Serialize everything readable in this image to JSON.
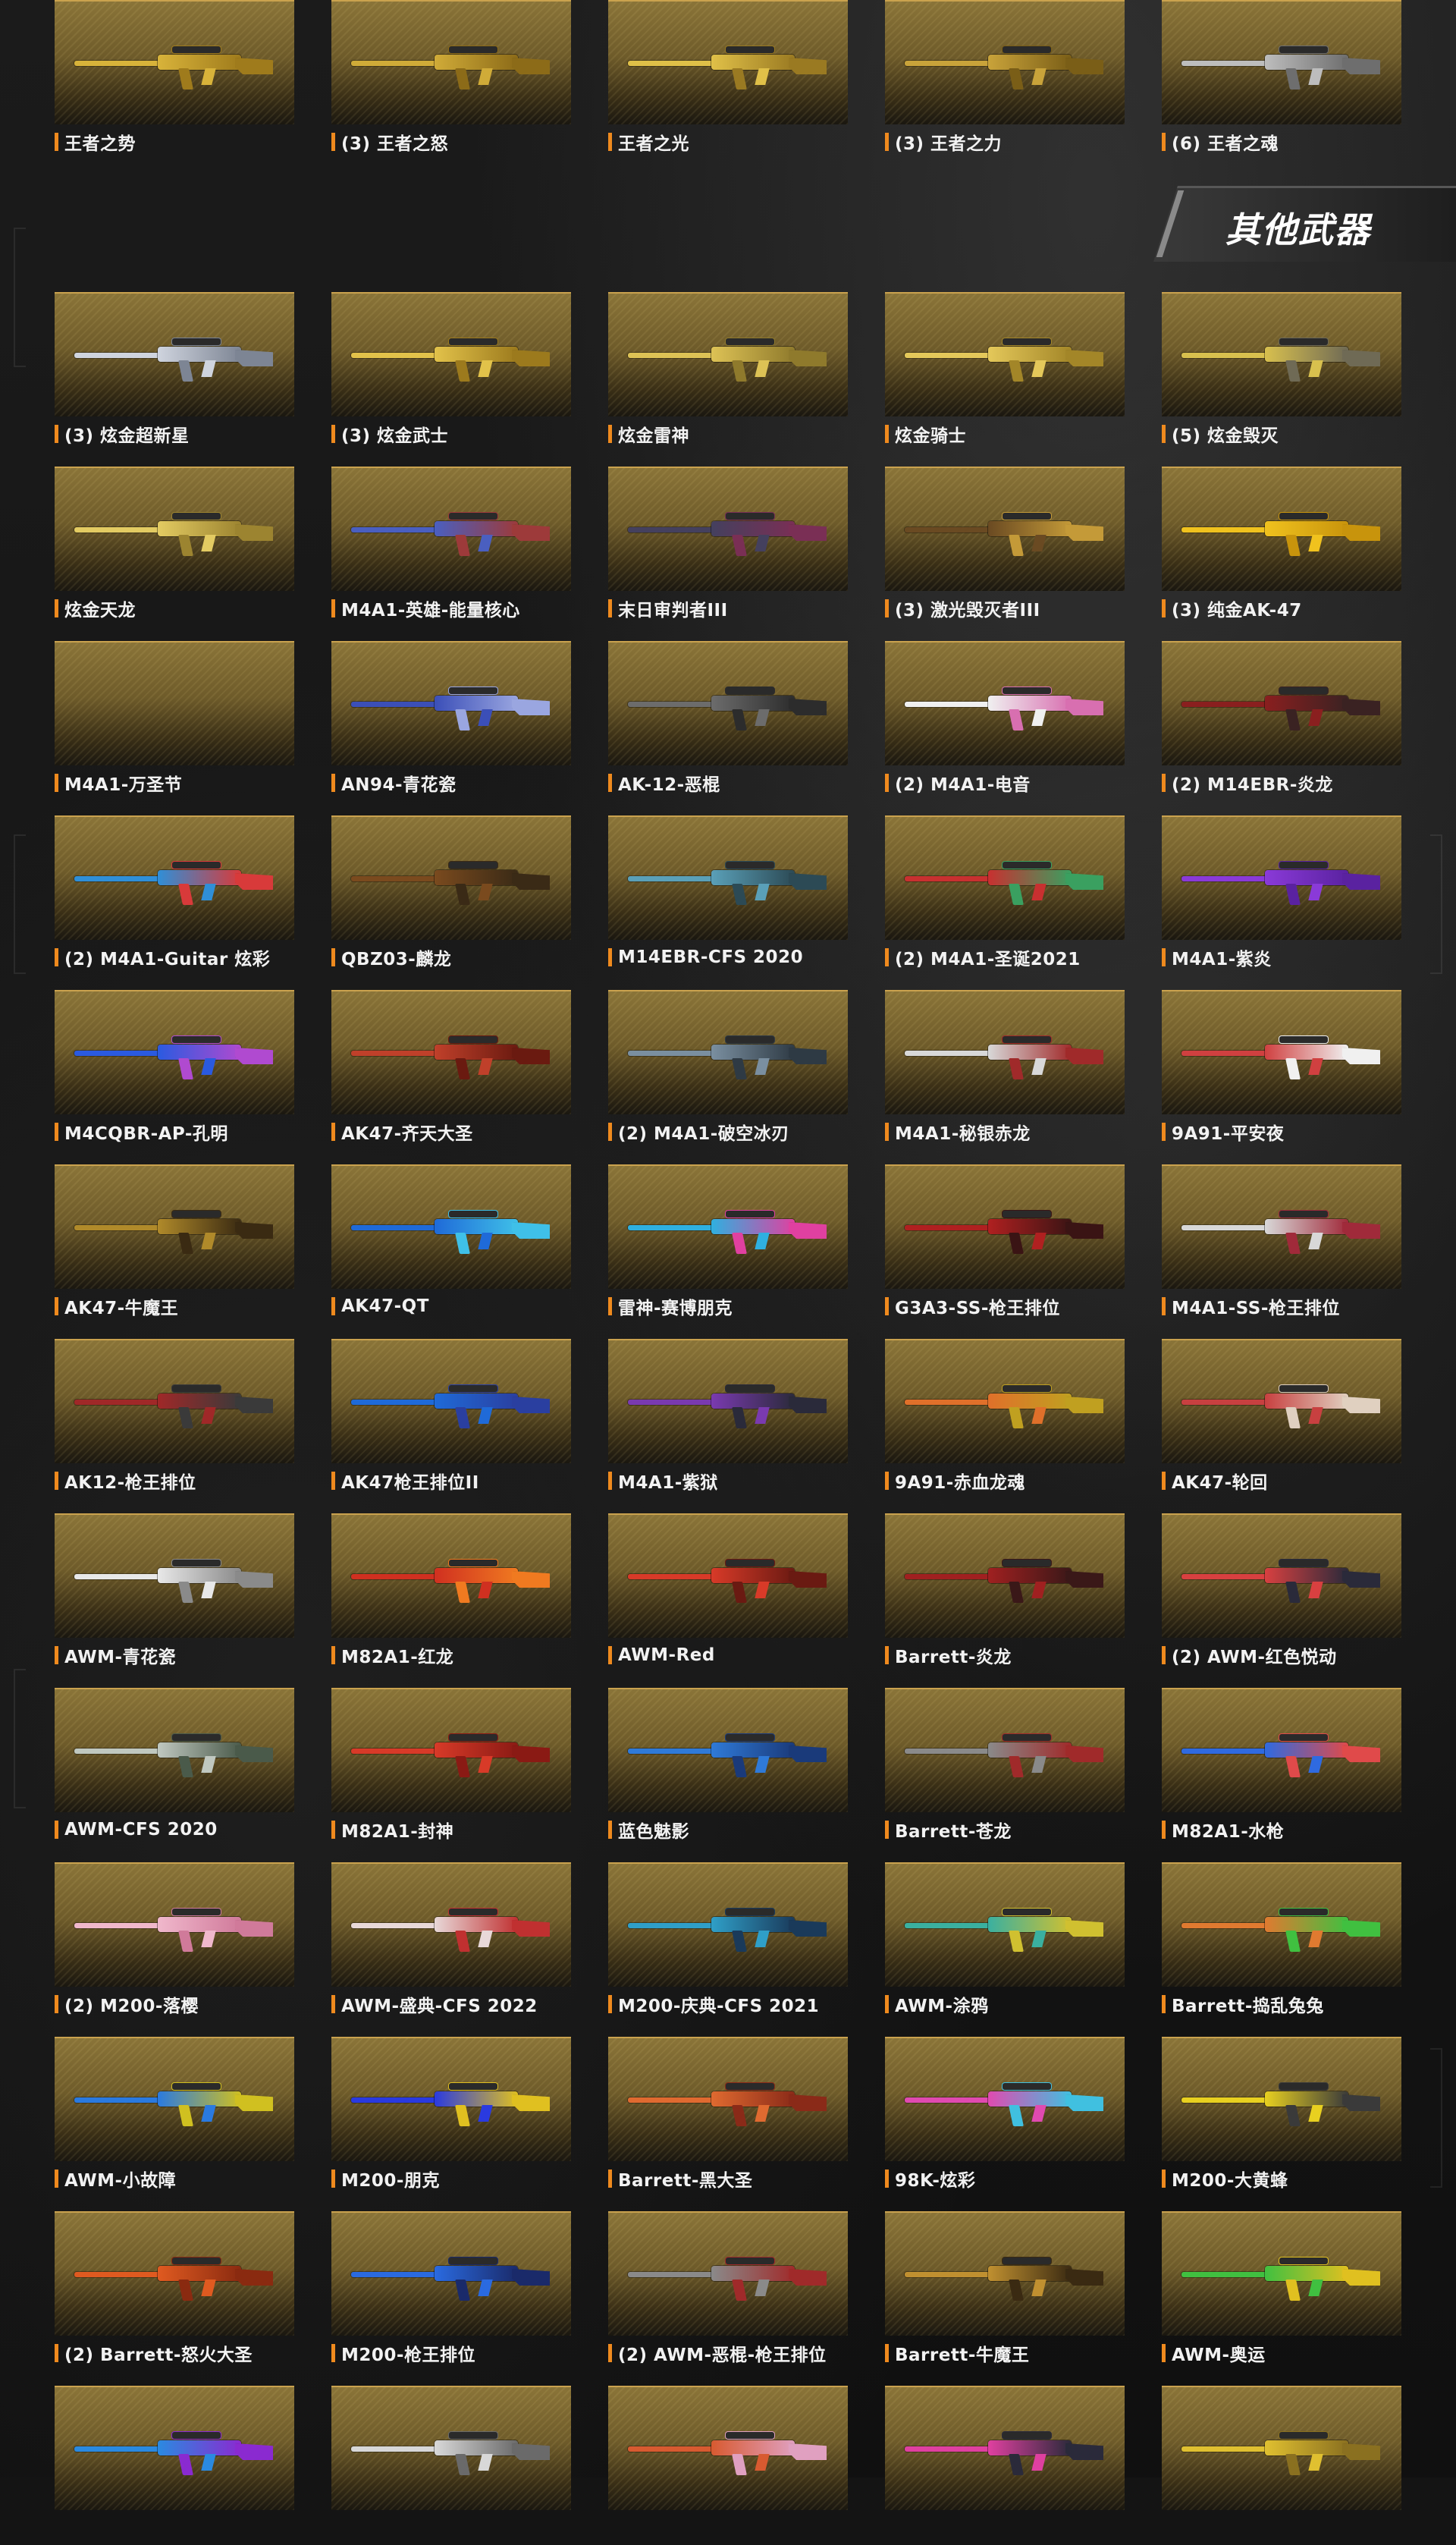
{
  "section": {
    "title": "其他武器"
  },
  "top_items": [
    {
      "name": "王者之势",
      "c1": "#d8b33a",
      "c2": "#9f7b1c"
    },
    {
      "name": "(3) 王者之怒",
      "c1": "#d0ab38",
      "c2": "#8c6b18"
    },
    {
      "name": "王者之光",
      "c1": "#e0c048",
      "c2": "#9a7a22"
    },
    {
      "name": "(3) 王者之力",
      "c1": "#c9a33a",
      "c2": "#7a5e17"
    },
    {
      "name": "(6) 王者之魂",
      "c1": "#bdbdbd",
      "c2": "#6e6e6e"
    }
  ],
  "items": [
    {
      "name": "(3) 炫金超新星",
      "c1": "#cfd4de",
      "c2": "#7d8594"
    },
    {
      "name": "(3) 炫金武士",
      "c1": "#e2c24a",
      "c2": "#9c7a1d"
    },
    {
      "name": "炫金雷神",
      "c1": "#ddc255",
      "c2": "#8f7a2c"
    },
    {
      "name": "炫金骑士",
      "c1": "#e4c85a",
      "c2": "#a38628"
    },
    {
      "name": "(5) 炫金毁灭",
      "c1": "#d8c04e",
      "c2": "#6f6a55"
    },
    {
      "name": "炫金天龙",
      "c1": "#e3cb62",
      "c2": "#9c8430"
    },
    {
      "name": "M4A1-英雄-能量核心",
      "c1": "#4a5fc0",
      "c2": "#9d3a3a"
    },
    {
      "name": "末日审判者III",
      "c1": "#44405e",
      "c2": "#7a2f55"
    },
    {
      "name": "(3) 激光毁灭者III",
      "c1": "#6a4a22",
      "c2": "#c49a38"
    },
    {
      "name": "(3) 纯金AK-47",
      "c1": "#f0c21e",
      "c2": "#c8940c"
    },
    {
      "name": "M4A1-万圣节",
      "c1": "#000000",
      "c2": "#000000"
    },
    {
      "name": "AN94-青花瓷",
      "c1": "#3b4fb8",
      "c2": "#9aa6e0"
    },
    {
      "name": "AK-12-恶棍",
      "c1": "#6c6c6c",
      "c2": "#2c2c2c"
    },
    {
      "name": "(2) M4A1-电音",
      "c1": "#f0f0f0",
      "c2": "#d86fb0"
    },
    {
      "name": "(2) M14EBR-炎龙",
      "c1": "#8a1f1f",
      "c2": "#3a2222"
    },
    {
      "name": "(2) M4A1-Guitar 炫彩",
      "c1": "#2f8fd8",
      "c2": "#d83a3a"
    },
    {
      "name": "QBZ03-麟龙",
      "c1": "#7a4a1e",
      "c2": "#3a2a16"
    },
    {
      "name": "M14EBR-CFS 2020",
      "c1": "#5aa0b8",
      "c2": "#2c4a55"
    },
    {
      "name": "(2) M4A1-圣诞2021",
      "c1": "#c83030",
      "c2": "#3aa060"
    },
    {
      "name": "M4A1-紫炎",
      "c1": "#8a3ad8",
      "c2": "#5a22a0"
    },
    {
      "name": "M4CQBR-AP-孔明",
      "c1": "#2a5ae0",
      "c2": "#b04ad0"
    },
    {
      "name": "AK47-齐天大圣",
      "c1": "#c0402a",
      "c2": "#6a1a10"
    },
    {
      "name": "(2) M4A1-破空冰刃",
      "c1": "#7a8fa0",
      "c2": "#2e3a44"
    },
    {
      "name": "M4A1-秘银赤龙",
      "c1": "#d8d8d8",
      "c2": "#a02a2a"
    },
    {
      "name": "9A91-平安夜",
      "c1": "#d04040",
      "c2": "#f0f0f0"
    },
    {
      "name": "AK47-牛魔王",
      "c1": "#b08a2a",
      "c2": "#3a2a12"
    },
    {
      "name": "AK47-QT",
      "c1": "#1f6ad8",
      "c2": "#3fc0e8"
    },
    {
      "name": "雷神-赛博朋克",
      "c1": "#2fb0e0",
      "c2": "#e040a0"
    },
    {
      "name": "G3A3-SS-枪王排位",
      "c1": "#b02020",
      "c2": "#3a1414"
    },
    {
      "name": "M4A1-SS-枪王排位",
      "c1": "#d8d8d8",
      "c2": "#a02a3a"
    },
    {
      "name": "AK12-枪王排位",
      "c1": "#a02828",
      "c2": "#3a3a3a"
    },
    {
      "name": "AK47枪王排位II",
      "c1": "#1f6ad8",
      "c2": "#2a3fa0"
    },
    {
      "name": "M4A1-紫狱",
      "c1": "#7a3ab0",
      "c2": "#2a2a3a"
    },
    {
      "name": "9A91-赤血龙魂",
      "c1": "#e0702a",
      "c2": "#c0a020"
    },
    {
      "name": "AK47-轮回",
      "c1": "#c84040",
      "c2": "#e0d0c0"
    },
    {
      "name": "AWM-青花瓷",
      "c1": "#e8e8e8",
      "c2": "#8a8a8a"
    },
    {
      "name": "M82A1-红龙",
      "c1": "#d03020",
      "c2": "#f07a20"
    },
    {
      "name": "AWM-Red",
      "c1": "#d83a28",
      "c2": "#6a1a12"
    },
    {
      "name": "Barrett-炎龙",
      "c1": "#a02020",
      "c2": "#3a1818"
    },
    {
      "name": "(2) AWM-红色悦动",
      "c1": "#d84040",
      "c2": "#2a2a3a"
    },
    {
      "name": "AWM-CFS 2020",
      "c1": "#c0c8c0",
      "c2": "#4a5a4a"
    },
    {
      "name": "M82A1-封神",
      "c1": "#d83a28",
      "c2": "#8a1a14"
    },
    {
      "name": "蓝色魅影",
      "c1": "#2f7ad8",
      "c2": "#1a3a7a"
    },
    {
      "name": "Barrett-苍龙",
      "c1": "#8a8a8a",
      "c2": "#a02a2a"
    },
    {
      "name": "M82A1-水枪",
      "c1": "#2f6ae0",
      "c2": "#e04a4a"
    },
    {
      "name": "(2) M200-落樱",
      "c1": "#f0b8cc",
      "c2": "#d07a9a"
    },
    {
      "name": "AWM-盛典-CFS 2022",
      "c1": "#e8d8d8",
      "c2": "#c03030"
    },
    {
      "name": "M200-庆典-CFS 2021",
      "c1": "#2f9fc8",
      "c2": "#1a3a5a"
    },
    {
      "name": "AWM-涂鸦",
      "c1": "#3ab0a0",
      "c2": "#d0c030"
    },
    {
      "name": "Barrett-捣乱兔兔",
      "c1": "#e07a30",
      "c2": "#40c040"
    },
    {
      "name": "AWM-小故障",
      "c1": "#2a7ae0",
      "c2": "#d0c020"
    },
    {
      "name": "M200-朋克",
      "c1": "#2a3ae0",
      "c2": "#e0c020"
    },
    {
      "name": "Barrett-黑大圣",
      "c1": "#e06a30",
      "c2": "#8a2a18"
    },
    {
      "name": "98K-炫彩",
      "c1": "#e04ab0",
      "c2": "#40c0e0"
    },
    {
      "name": "M200-大黄蜂",
      "c1": "#e8d020",
      "c2": "#3a3a3a"
    },
    {
      "name": "(2) Barrett-怒火大圣",
      "c1": "#e05a20",
      "c2": "#8a2a10"
    },
    {
      "name": "M200-枪王排位",
      "c1": "#2a6ae0",
      "c2": "#1a2a6a"
    },
    {
      "name": "(2) AWM-恶棍-枪王排位",
      "c1": "#8a8a8a",
      "c2": "#a02a2a"
    },
    {
      "name": "Barrett-牛魔王",
      "c1": "#c09030",
      "c2": "#3a2a12"
    },
    {
      "name": "AWM-奥运",
      "c1": "#40c040",
      "c2": "#e0c020"
    },
    {
      "name": "",
      "c1": "#2a8ae0",
      "c2": "#8a2ad0"
    },
    {
      "name": "",
      "c1": "#d8d8d8",
      "c2": "#6a6a6a"
    },
    {
      "name": "",
      "c1": "#d85a30",
      "c2": "#e0a0c0"
    },
    {
      "name": "",
      "c1": "#e040a0",
      "c2": "#2a2a3a"
    },
    {
      "name": "",
      "c1": "#e0c030",
      "c2": "#8a7020"
    }
  ]
}
